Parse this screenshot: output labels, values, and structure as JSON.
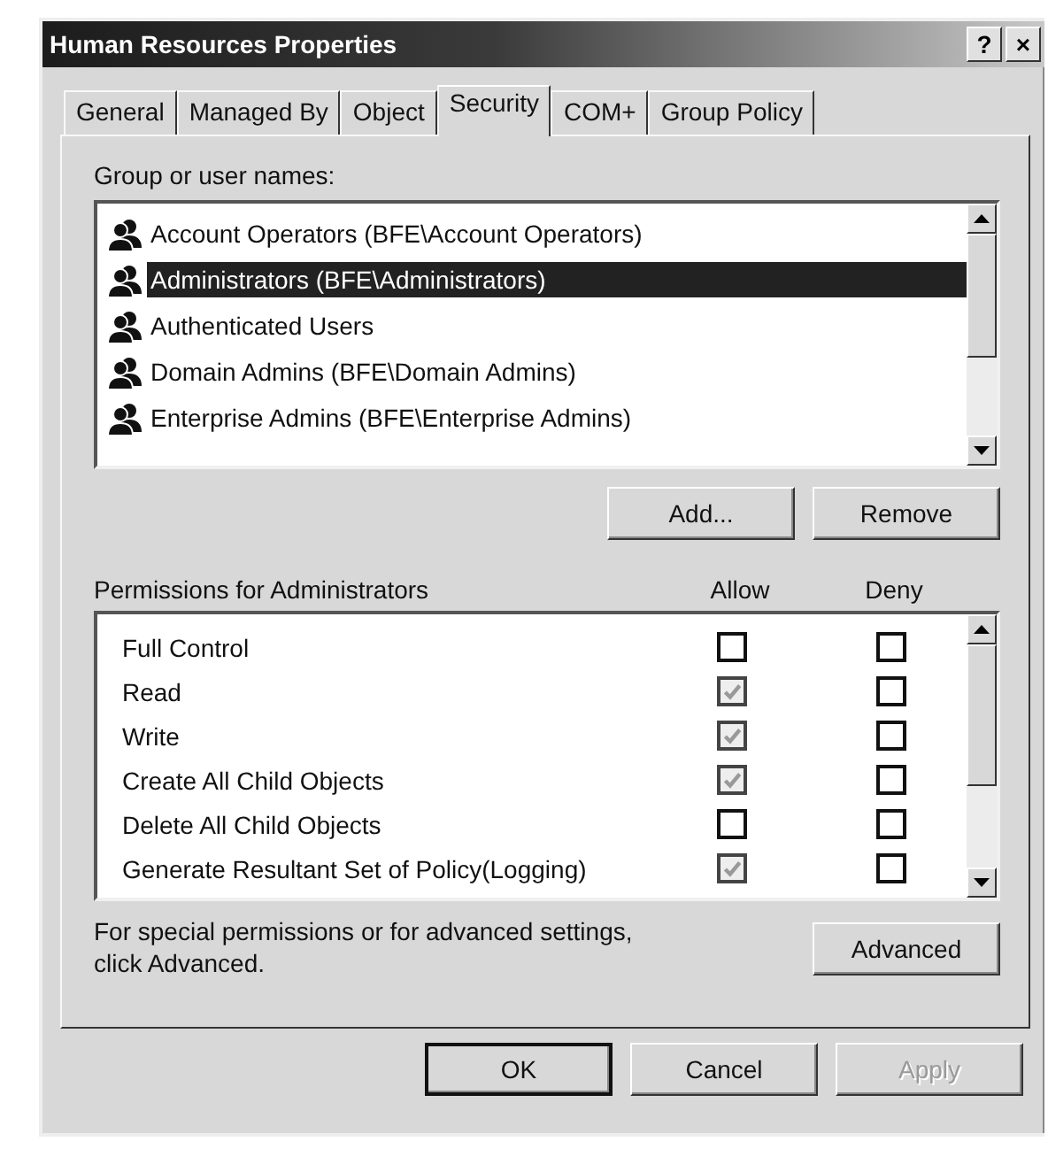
{
  "window": {
    "title": "Human Resources Properties",
    "title_buttons": [
      "?",
      "×"
    ]
  },
  "tabs": [
    {
      "label": "General",
      "selected": false
    },
    {
      "label": "Managed By",
      "selected": false
    },
    {
      "label": "Object",
      "selected": false
    },
    {
      "label": "Security",
      "selected": true
    },
    {
      "label": "COM+",
      "selected": false
    },
    {
      "label": "Group Policy",
      "selected": false
    }
  ],
  "group_list": {
    "label": "Group or user names:",
    "items": [
      {
        "name": "Account Operators (BFE\\Account Operators)",
        "selected": false
      },
      {
        "name": "Administrators (BFE\\Administrators)",
        "selected": true
      },
      {
        "name": "Authenticated Users",
        "selected": false
      },
      {
        "name": "Domain Admins (BFE\\Domain Admins)",
        "selected": false
      },
      {
        "name": "Enterprise Admins (BFE\\Enterprise Admins)",
        "selected": false
      }
    ]
  },
  "group_buttons": [
    {
      "label": "Add..."
    },
    {
      "label": "Remove"
    }
  ],
  "permissions": {
    "label": "Permissions for Administrators",
    "columns": [
      "Allow",
      "Deny"
    ],
    "rows": [
      {
        "name": "Full Control",
        "allow": {
          "checked": false,
          "disabled": false
        },
        "deny": {
          "checked": false,
          "disabled": false
        }
      },
      {
        "name": "Read",
        "allow": {
          "checked": true,
          "disabled": true
        },
        "deny": {
          "checked": false,
          "disabled": false
        }
      },
      {
        "name": "Write",
        "allow": {
          "checked": true,
          "disabled": true
        },
        "deny": {
          "checked": false,
          "disabled": false
        }
      },
      {
        "name": "Create All Child Objects",
        "allow": {
          "checked": true,
          "disabled": true
        },
        "deny": {
          "checked": false,
          "disabled": false
        }
      },
      {
        "name": "Delete All Child Objects",
        "allow": {
          "checked": false,
          "disabled": false
        },
        "deny": {
          "checked": false,
          "disabled": false
        }
      },
      {
        "name": "Generate Resultant Set of Policy(Logging)",
        "allow": {
          "checked": true,
          "disabled": true
        },
        "deny": {
          "checked": false,
          "disabled": false
        }
      }
    ]
  },
  "advanced_note": "For special permissions or for advanced settings, click Advanced.",
  "advanced_button": {
    "label": "Advanced"
  },
  "buttons": [
    {
      "label": "OK",
      "disabled": false,
      "default": true
    },
    {
      "label": "Cancel",
      "disabled": false,
      "default": false
    },
    {
      "label": "Apply",
      "disabled": true,
      "default": false
    }
  ]
}
